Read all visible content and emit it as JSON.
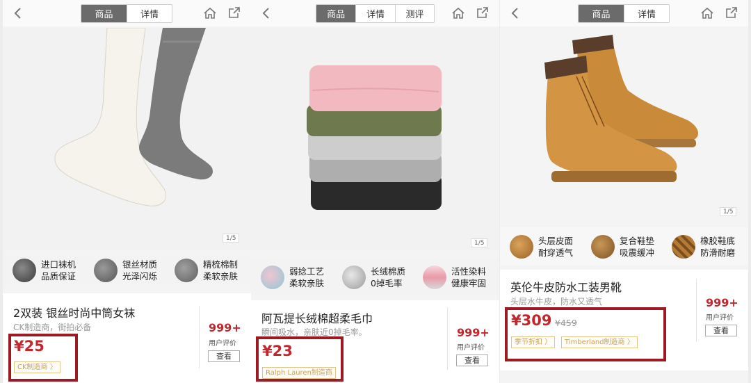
{
  "panels": [
    {
      "tabs": [
        "商品",
        "详情"
      ],
      "pager": "1/5",
      "features": [
        {
          "icon": "socks-icon",
          "line1": "进口袜机",
          "line2": "品质保证"
        },
        {
          "icon": "silk-icon",
          "line1": "银丝材质",
          "line2": "光泽闪烁"
        },
        {
          "icon": "cotton-icon",
          "line1": "精梳棉制",
          "line2": "柔软亲肤"
        }
      ],
      "title": "2双装 银丝时尚中筒女袜",
      "subtitle": "CK制造商，街拍必备",
      "price": "¥25",
      "tags": [
        "CK制造商 〉"
      ],
      "reviews_count": "999+",
      "reviews_label": "用户评价",
      "view_button": "查看"
    },
    {
      "tabs": [
        "商品",
        "详情",
        "测评"
      ],
      "pager": "1/5",
      "features": [
        {
          "icon": "fabric-icon",
          "line1": "弱捻工艺",
          "line2": "柔软亲肤"
        },
        {
          "icon": "fiber-icon",
          "line1": "长绒棉质",
          "line2": "0掉毛率"
        },
        {
          "icon": "dye-icon",
          "line1": "活性染料",
          "line2": "健康牢固"
        }
      ],
      "title": "阿瓦提长绒棉超柔毛巾",
      "subtitle": "瞬间吸水，亲肤近0掉毛率。",
      "price": "¥23",
      "tags": [
        "Ralph Lauren制造商"
      ],
      "reviews_count": "999+",
      "reviews_label": "用户评价",
      "view_button": "查看"
    },
    {
      "tabs": [
        "商品",
        "详情"
      ],
      "pager": "1/5",
      "features": [
        {
          "icon": "leather-icon",
          "line1": "头层皮面",
          "line2": "耐穿透气"
        },
        {
          "icon": "insole-icon",
          "line1": "复合鞋垫",
          "line2": "吸震缓冲"
        },
        {
          "icon": "sole-icon",
          "line1": "橡胶鞋底",
          "line2": "防滑耐磨"
        }
      ],
      "title": "英伦牛皮防水工装男靴",
      "subtitle": "头层水牛皮，防水又透气",
      "price": "¥309",
      "old_price": "¥459",
      "tags": [
        "季节折扣 〉",
        "Timberland制造商 〉"
      ],
      "reviews_count": "999+",
      "reviews_label": "用户评价",
      "view_button": "查看"
    }
  ],
  "colors": {
    "accent": "#c1272d",
    "highlight_box": "#9c1b22",
    "tab_active": "#6b6b6b"
  }
}
